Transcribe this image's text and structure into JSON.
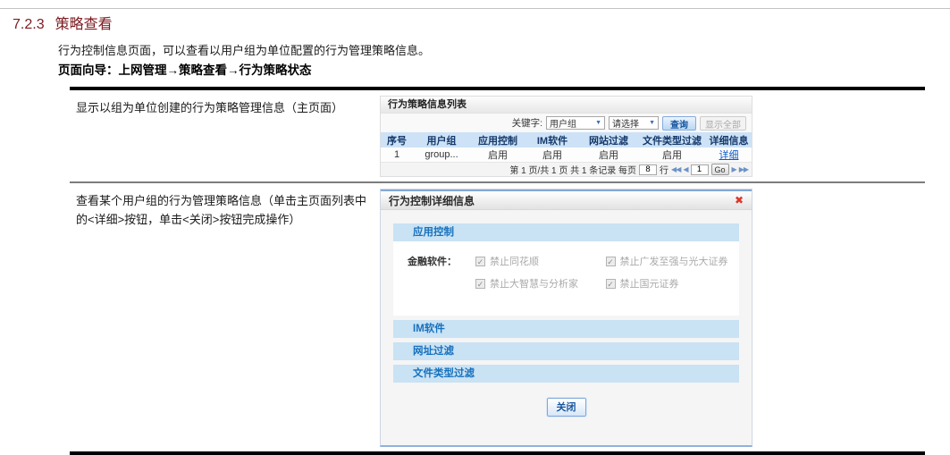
{
  "document": {
    "section_number": "7.2.3",
    "section_title": "策略查看",
    "intro": "行为控制信息页面，可以查看以用户组为单位配置的行为管理策略信息。",
    "wizard": "页面向导：上网管理→策略查看→行为策略状态"
  },
  "doc_rows": [
    {
      "description": "显示以组为单位创建的行为策略管理信息（主页面）"
    },
    {
      "description": "查看某个用户组的行为管理策略信息（单击主页面列表中的<详细>按钮，单击<关闭>按钮完成操作）"
    }
  ],
  "policy_list": {
    "title": "行为策略信息列表",
    "keyword_label": "关键字:",
    "keyword_select_value": "用户组",
    "second_select_value": "请选择",
    "dropdown_arrow": "▼",
    "query_button": "查询",
    "show_all_button": "显示全部",
    "columns": [
      "序号",
      "用户组",
      "应用控制",
      "IM软件",
      "网站过滤",
      "文件类型过滤",
      "详细信息"
    ],
    "row": {
      "no": "1",
      "group": "group...",
      "app_control": "启用",
      "im": "启用",
      "web": "启用",
      "file": "启用",
      "detail_link": "详细"
    },
    "pager": {
      "info_text": "第 1 页/共 1 页 共 1 条记录 每页",
      "page_size": "8",
      "rows_label": "行",
      "first_arrow": "◀◀",
      "prev_arrow": "◀",
      "page_input": "1",
      "go_label": "Go",
      "next_arrow": "▶",
      "last_arrow": "▶▶"
    }
  },
  "detail_dialog": {
    "title": "行为控制详细信息",
    "close_icon": "✖",
    "sections": [
      "应用控制",
      "IM软件",
      "网址过滤",
      "文件类型过滤"
    ],
    "finance_label": "金融软件：",
    "check_glyph": "✓",
    "checkboxes": [
      "禁止同花顺",
      "禁止广发至强与光大证券",
      "禁止大智慧与分析家",
      "禁止国元证券"
    ],
    "close_button": "关闭"
  },
  "colors": {
    "heading_red": "#7c1b20",
    "table_header_bg": "#cde2f6",
    "section_bar_bg": "#c9e2f4",
    "section_text_blue": "#1771bd",
    "link_blue": "#0a59c8",
    "close_icon_red": "#dd372b"
  }
}
